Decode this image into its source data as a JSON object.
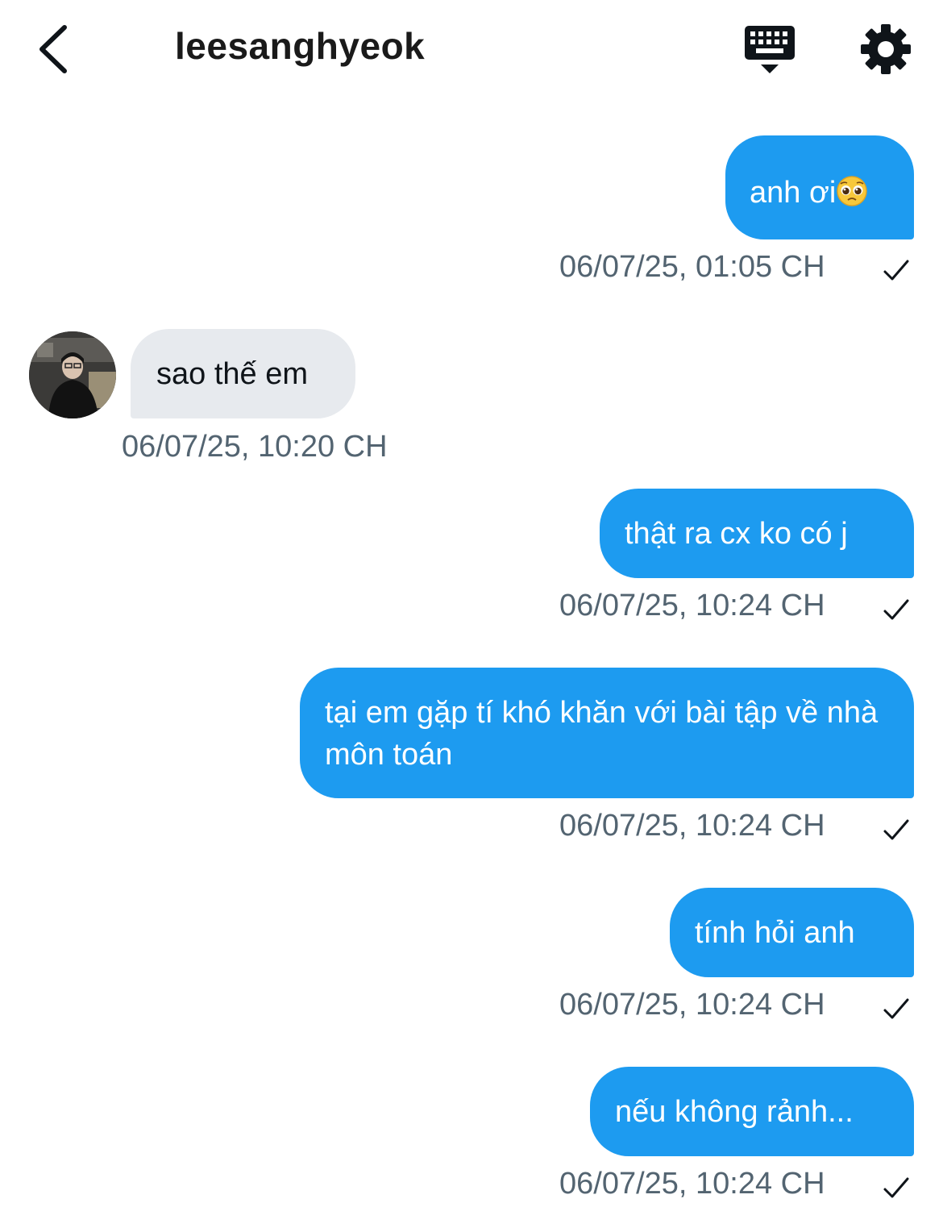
{
  "header": {
    "title": "leesanghyeok",
    "back_icon": "chevron-left-icon",
    "keyboard_icon": "keyboard-icon",
    "settings_icon": "gear-icon"
  },
  "colors": {
    "outgoing_bubble": "#1d9bf0",
    "incoming_bubble": "#e7eaee",
    "timestamp": "#536471"
  },
  "messages": [
    {
      "direction": "outgoing",
      "text": "anh ơi",
      "emoji": "pleading-face-emoji",
      "timestamp": "06/07/25, 01:05 CH",
      "status": "check-icon"
    },
    {
      "direction": "incoming",
      "text": "sao thế em",
      "timestamp": "06/07/25, 10:20 CH"
    },
    {
      "direction": "outgoing",
      "text": "thật ra cx ko có j",
      "timestamp": "06/07/25, 10:24 CH",
      "status": "check-icon"
    },
    {
      "direction": "outgoing",
      "text": "tại em gặp tí khó khăn với bài tập về nhà môn toán",
      "timestamp": "06/07/25, 10:24 CH",
      "status": "check-icon"
    },
    {
      "direction": "outgoing",
      "text": "tính hỏi anh",
      "timestamp": "06/07/25, 10:24 CH",
      "status": "check-icon"
    },
    {
      "direction": "outgoing",
      "text": "nếu không rảnh...",
      "timestamp": "06/07/25, 10:24 CH",
      "status": "check-icon"
    }
  ]
}
